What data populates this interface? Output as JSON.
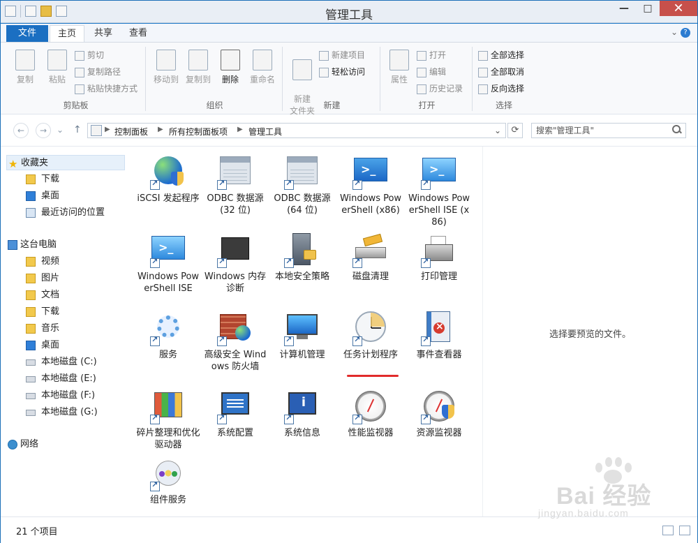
{
  "window": {
    "title": "管理工具",
    "controls": {
      "minimize": "—",
      "maximize": "□",
      "close": "✕"
    }
  },
  "ribbon_tabs": [
    {
      "label": "文件"
    },
    {
      "label": "主页"
    },
    {
      "label": "共享"
    },
    {
      "label": "查看"
    }
  ],
  "ribbon": {
    "groups": [
      {
        "label": "剪贴板",
        "big_buttons": [
          "复制",
          "粘贴"
        ],
        "small_buttons": [
          "剪切",
          "复制路径",
          "粘贴快捷方式"
        ]
      },
      {
        "label": "组织",
        "big_buttons": [
          "移动到",
          "复制到",
          "删除",
          "重命名"
        ]
      },
      {
        "label": "新建",
        "big_buttons": [
          "新建\n文件夹"
        ],
        "small_buttons": [
          "新建项目",
          "轻松访问"
        ]
      },
      {
        "label": "打开",
        "big_buttons": [
          "属性"
        ],
        "small_buttons": [
          "打开",
          "编辑",
          "历史记录"
        ]
      },
      {
        "label": "选择",
        "small_buttons": [
          "全部选择",
          "全部取消",
          "反向选择"
        ]
      }
    ]
  },
  "address": {
    "crumbs": [
      "控制面板",
      "所有控制面板项",
      "管理工具"
    ],
    "search_placeholder": "搜索\"管理工具\""
  },
  "nav": {
    "items": [
      {
        "label": "收藏夹",
        "icon": "star-icon",
        "level": 0,
        "selected": true
      },
      {
        "label": "下载",
        "icon": "folder-icon",
        "level": 1
      },
      {
        "label": "桌面",
        "icon": "desktop-icon",
        "level": 1
      },
      {
        "label": "最近访问的位置",
        "icon": "recent-icon",
        "level": 1
      },
      {
        "label": "这台电脑",
        "icon": "pc-icon",
        "level": 0
      },
      {
        "label": "视频",
        "icon": "folder-icon",
        "level": 1
      },
      {
        "label": "图片",
        "icon": "folder-icon",
        "level": 1
      },
      {
        "label": "文档",
        "icon": "folder-icon",
        "level": 1
      },
      {
        "label": "下载",
        "icon": "folder-icon",
        "level": 1
      },
      {
        "label": "音乐",
        "icon": "folder-icon",
        "level": 1
      },
      {
        "label": "桌面",
        "icon": "desktop-icon",
        "level": 1
      },
      {
        "label": "本地磁盘 (C:)",
        "icon": "drive-icon",
        "level": 1
      },
      {
        "label": "本地磁盘 (E:)",
        "icon": "drive-icon",
        "level": 1
      },
      {
        "label": "本地磁盘 (F:)",
        "icon": "drive-icon",
        "level": 1
      },
      {
        "label": "本地磁盘 (G:)",
        "icon": "drive-icon",
        "level": 1
      },
      {
        "label": "网络",
        "icon": "network-icon",
        "level": 0
      }
    ]
  },
  "files": [
    {
      "label": "iSCSI 发起程序",
      "icon": "iscsi-icon"
    },
    {
      "label": "ODBC 数据源(32 位)",
      "icon": "odbc-icon"
    },
    {
      "label": "ODBC 数据源(64 位)",
      "icon": "odbc-icon"
    },
    {
      "label": "Windows PowerShell (x86)",
      "icon": "powershell-icon"
    },
    {
      "label": "Windows PowerShell ISE (x86)",
      "icon": "powershell-ise-icon"
    },
    {
      "label": "Windows PowerShell ISE",
      "icon": "powershell-ise-icon"
    },
    {
      "label": "Windows 内存诊断",
      "icon": "memory-icon"
    },
    {
      "label": "本地安全策略",
      "icon": "local-security-icon"
    },
    {
      "label": "磁盘清理",
      "icon": "disk-cleanup-icon"
    },
    {
      "label": "打印管理",
      "icon": "printer-icon"
    },
    {
      "label": "服务",
      "icon": "services-icon"
    },
    {
      "label": "高级安全 Windows 防火墙",
      "icon": "firewall-icon"
    },
    {
      "label": "计算机管理",
      "icon": "computer-management-icon"
    },
    {
      "label": "任务计划程序",
      "icon": "task-scheduler-icon"
    },
    {
      "label": "事件查看器",
      "icon": "event-viewer-icon"
    },
    {
      "label": "碎片整理和优化驱动器",
      "icon": "defrag-icon"
    },
    {
      "label": "系统配置",
      "icon": "system-config-icon"
    },
    {
      "label": "系统信息",
      "icon": "system-info-icon"
    },
    {
      "label": "性能监视器",
      "icon": "performance-monitor-icon"
    },
    {
      "label": "资源监视器",
      "icon": "resource-monitor-icon"
    },
    {
      "label": "组件服务",
      "icon": "component-services-icon"
    }
  ],
  "preview": {
    "message": "选择要预览的文件。"
  },
  "status": {
    "count": "21 个项目"
  },
  "watermark": {
    "main": "Bai 经验",
    "sub": "jingyan.baidu.com"
  }
}
